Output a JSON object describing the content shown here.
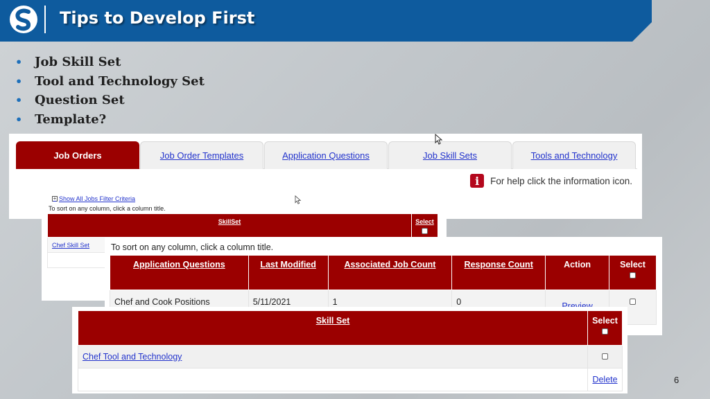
{
  "slide": {
    "title": "Tips to Develop First",
    "page_number": "6"
  },
  "bullets": [
    "Job Skill Set",
    "Tool and Technology Set",
    "Question Set",
    "Template?"
  ],
  "tabs": [
    "Job Orders",
    "Job Order Templates",
    "Application Questions",
    "Job Skill Sets",
    "Tools and Technology"
  ],
  "help": {
    "icon": "i",
    "text": "For help click the information icon."
  },
  "skillset_panel": {
    "filter_link": "Show All Jobs Filter Criteria",
    "sort_hint": "To sort on any column, click a column title.",
    "headers": {
      "skillset": "SkillSet",
      "select": "Select"
    },
    "row_link": "Chef Skill Set"
  },
  "questions_panel": {
    "sort_hint": "To sort on any column, click a column title.",
    "headers": {
      "question": "Application Questions",
      "modified": "Last Modified",
      "job_count": "Associated Job Count",
      "response_count": "Response Count",
      "action": "Action",
      "select": "Select"
    },
    "row": {
      "question": "Chef and Cook Positions",
      "modified": "5/11/2021",
      "job_count": "1",
      "response_count": "0",
      "action": "Preview"
    }
  },
  "tools_panel": {
    "headers": {
      "skill_set": "Skill Set",
      "select": "Select"
    },
    "row_link": "Chef Tool and Technology",
    "delete_link": "Delete"
  },
  "colors": {
    "header_blue": "#0e5b9e",
    "table_red": "#9b0000",
    "link_blue": "#2233cc",
    "bullet_blue": "#1d6fba"
  }
}
